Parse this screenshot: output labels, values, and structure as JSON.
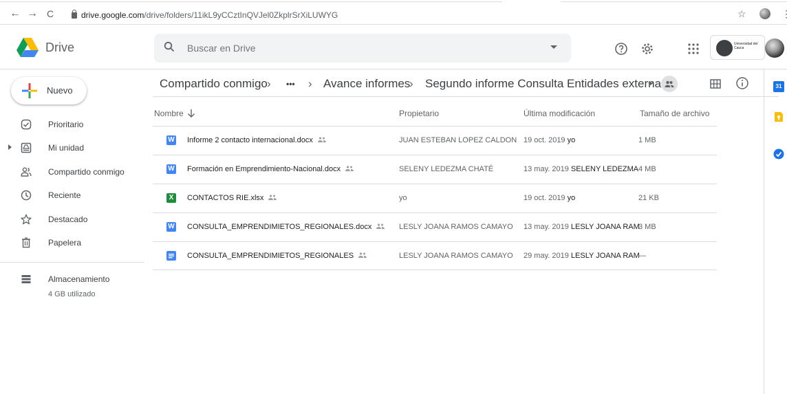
{
  "browser": {
    "back_glyph": "←",
    "forward_glyph": "→",
    "reload_glyph": "C",
    "url_host": "drive.google.com",
    "url_path": "/drive/folders/11ikL9yCCztInQVJel0ZkplrSrXiLUWYG",
    "star_glyph": "☆",
    "menu_glyph": "⋮"
  },
  "header": {
    "brand": "Drive",
    "search_placeholder": "Buscar en Drive",
    "account_name": "Universidad del Cauca"
  },
  "sidebar": {
    "new_label": "Nuevo",
    "items": [
      {
        "label": "Prioritario",
        "icon": "check-circle-icon"
      },
      {
        "label": "Mi unidad",
        "icon": "my-drive-icon"
      },
      {
        "label": "Compartido conmigo",
        "icon": "shared-people-icon"
      },
      {
        "label": "Reciente",
        "icon": "clock-icon"
      },
      {
        "label": "Destacado",
        "icon": "star-icon"
      },
      {
        "label": "Papelera",
        "icon": "trash-icon"
      }
    ],
    "storage_label": "Almacenamiento",
    "storage_used": "4 GB utilizado"
  },
  "breadcrumb": {
    "items": [
      "Compartido conmigo",
      "•••",
      "Avance informes",
      "Segundo informe Consulta Entidades externas"
    ],
    "separator": "›"
  },
  "table": {
    "headers": {
      "name": "Nombre",
      "owner": "Propietario",
      "modified": "Última modificación",
      "size": "Tamaño de archivo"
    },
    "rows": [
      {
        "name": "Informe 2 contacto internacional.docx",
        "type": "word",
        "badge": "W",
        "owner": "JUAN ESTEBAN LOPEZ CALDON",
        "mod_date": "19 oct. 2019",
        "mod_by": "yo",
        "size": "1 MB"
      },
      {
        "name": "Formación en Emprendimiento-Nacional.docx",
        "type": "word",
        "badge": "W",
        "owner": "SELENY LEDEZMA CHATÉ",
        "mod_date": "13 may. 2019",
        "mod_by": "SELENY LEDEZMA",
        "size": "4 MB"
      },
      {
        "name": "CONTACTOS RIE.xlsx",
        "type": "excel",
        "badge": "X",
        "owner": "yo",
        "mod_date": "19 oct. 2019",
        "mod_by": "yo",
        "size": "21 KB"
      },
      {
        "name": "CONSULTA_EMPRENDIMIETOS_REGIONALES.docx",
        "type": "word",
        "badge": "W",
        "owner": "LESLY JOANA RAMOS CAMAYO",
        "mod_date": "13 may. 2019",
        "mod_by": "LESLY JOANA RAM",
        "size": "3 MB"
      },
      {
        "name": "CONSULTA_EMPRENDIMIETOS_REGIONALES",
        "type": "gdoc",
        "badge": "",
        "owner": "LESLY JOANA RAMOS CAMAYO",
        "mod_date": "29 may. 2019",
        "mod_by": "LESLY JOANA RAM",
        "size": "—"
      }
    ]
  },
  "right_panel": {
    "calendar_label": "31"
  },
  "colors": {
    "word": "#4285f4",
    "excel": "#1e8e3e",
    "gdoc": "#4285f4",
    "keep": "#fbbc04",
    "tasks": "#1a73e8"
  }
}
